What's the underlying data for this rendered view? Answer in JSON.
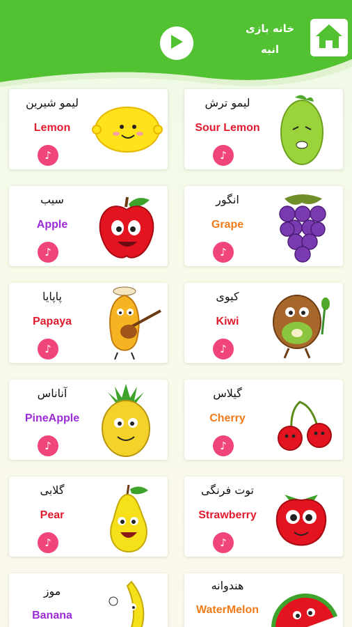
{
  "header": {
    "brand_line1": "خانه بازی",
    "brand_line2": "انبه",
    "home_icon": "home-icon",
    "play_icon": "play-icon"
  },
  "colors": {
    "header_green": "#52c232",
    "sound_pink": "#f0457a",
    "red_text": "#e01b2e",
    "purple_text": "#9b2bd6",
    "orange_text": "#f07b1a"
  },
  "fruits": [
    {
      "fa": "لیمو شیرین",
      "en": "Lemon",
      "color": "#e01b2e"
    },
    {
      "fa": "لیمو ترش",
      "en": "Sour Lemon",
      "color": "#e01b2e"
    },
    {
      "fa": "سیب",
      "en": "Apple",
      "color": "#9b2bd6"
    },
    {
      "fa": "انگور",
      "en": "Grape",
      "color": "#f07b1a"
    },
    {
      "fa": "پاپایا",
      "en": "Papaya",
      "color": "#e01b2e"
    },
    {
      "fa": "کیوی",
      "en": "Kiwi",
      "color": "#e01b2e"
    },
    {
      "fa": "آناناس",
      "en": "PineApple",
      "color": "#9b2bd6"
    },
    {
      "fa": "گیلاس",
      "en": "Cherry",
      "color": "#f07b1a"
    },
    {
      "fa": "گلابی",
      "en": "Pear",
      "color": "#e01b2e"
    },
    {
      "fa": "توت فرنگی",
      "en": "Strawberry",
      "color": "#e01b2e"
    },
    {
      "fa": "موز",
      "en": "Banana",
      "color": "#9b2bd6"
    },
    {
      "fa": "هندوانه",
      "en": "WaterMelon",
      "color": "#f07b1a"
    }
  ]
}
